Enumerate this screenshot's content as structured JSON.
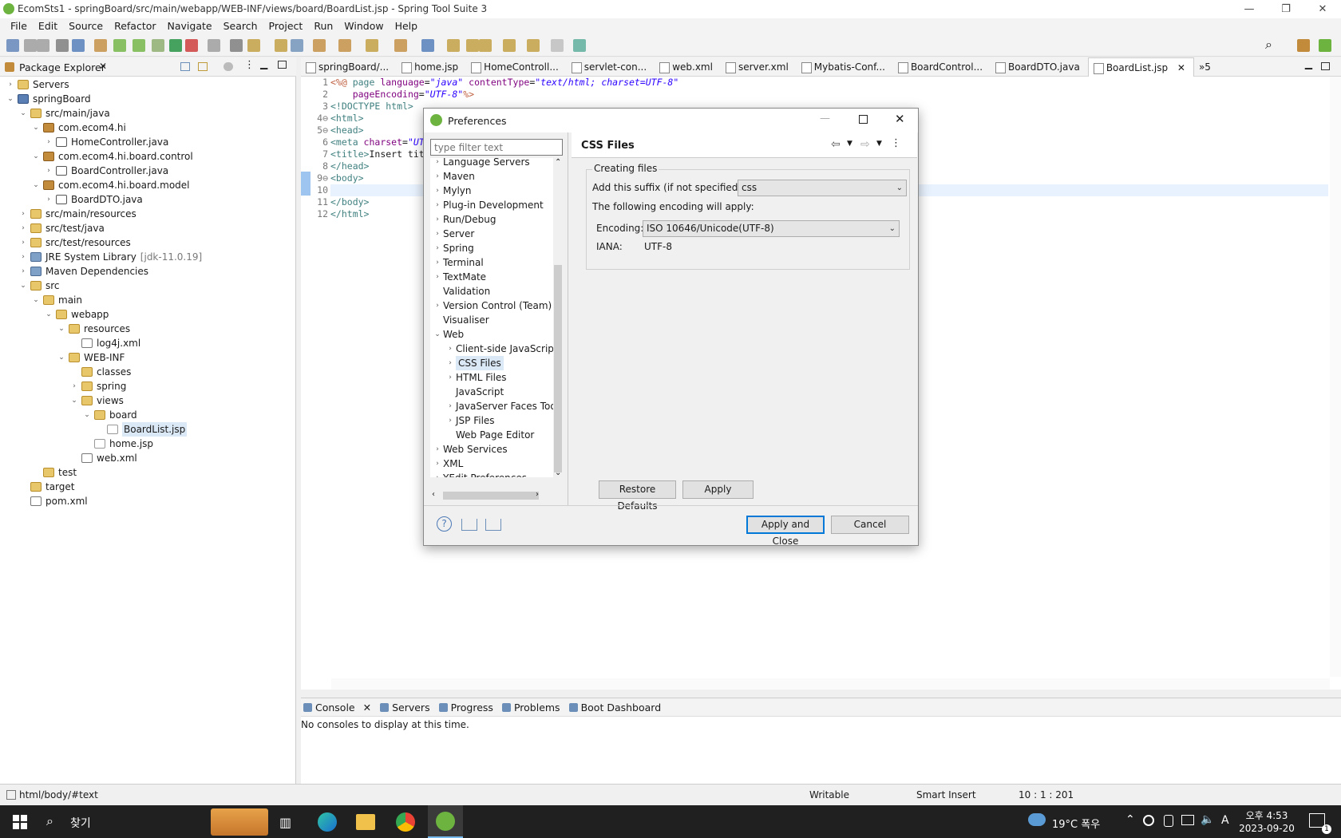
{
  "window": {
    "title": "EcomSts1 - springBoard/src/main/webapp/WEB-INF/views/board/BoardList.jsp - Spring Tool Suite 3",
    "minimize": "—",
    "maximize": "❐",
    "close": "✕"
  },
  "menu": [
    "File",
    "Edit",
    "Source",
    "Refactor",
    "Navigate",
    "Search",
    "Project",
    "Run",
    "Window",
    "Help"
  ],
  "package_explorer": {
    "title": "Package Explorer",
    "nodes": [
      {
        "label": "Servers",
        "depth": 0,
        "tw": "›",
        "icon": "folder"
      },
      {
        "label": "springBoard",
        "depth": 0,
        "tw": "⌄",
        "icon": "proj"
      },
      {
        "label": "src/main/java",
        "depth": 1,
        "tw": "⌄",
        "icon": "folder"
      },
      {
        "label": "com.ecom4.hi",
        "depth": 2,
        "tw": "⌄",
        "icon": "pkg"
      },
      {
        "label": "HomeController.java",
        "depth": 3,
        "tw": "›",
        "icon": "java"
      },
      {
        "label": "com.ecom4.hi.board.control",
        "depth": 2,
        "tw": "⌄",
        "icon": "pkg"
      },
      {
        "label": "BoardController.java",
        "depth": 3,
        "tw": "›",
        "icon": "java"
      },
      {
        "label": "com.ecom4.hi.board.model",
        "depth": 2,
        "tw": "⌄",
        "icon": "pkg"
      },
      {
        "label": "BoardDTO.java",
        "depth": 3,
        "tw": "›",
        "icon": "java"
      },
      {
        "label": "src/main/resources",
        "depth": 1,
        "tw": "›",
        "icon": "folder"
      },
      {
        "label": "src/test/java",
        "depth": 1,
        "tw": "›",
        "icon": "folder"
      },
      {
        "label": "src/test/resources",
        "depth": 1,
        "tw": "›",
        "icon": "folder"
      },
      {
        "label": "JRE System Library",
        "suffix": "[jdk-11.0.19]",
        "depth": 1,
        "tw": "›",
        "icon": "lib"
      },
      {
        "label": "Maven Dependencies",
        "depth": 1,
        "tw": "›",
        "icon": "lib"
      },
      {
        "label": "src",
        "depth": 1,
        "tw": "⌄",
        "icon": "folder"
      },
      {
        "label": "main",
        "depth": 2,
        "tw": "⌄",
        "icon": "folder"
      },
      {
        "label": "webapp",
        "depth": 3,
        "tw": "⌄",
        "icon": "folder"
      },
      {
        "label": "resources",
        "depth": 4,
        "tw": "⌄",
        "icon": "folder"
      },
      {
        "label": "log4j.xml",
        "depth": 5,
        "tw": "",
        "icon": "xml"
      },
      {
        "label": "WEB-INF",
        "depth": 4,
        "tw": "⌄",
        "icon": "folder"
      },
      {
        "label": "classes",
        "depth": 5,
        "tw": "",
        "icon": "folder"
      },
      {
        "label": "spring",
        "depth": 5,
        "tw": "›",
        "icon": "folder"
      },
      {
        "label": "views",
        "depth": 5,
        "tw": "⌄",
        "icon": "folder"
      },
      {
        "label": "board",
        "depth": 6,
        "tw": "⌄",
        "icon": "folder"
      },
      {
        "label": "BoardList.jsp",
        "depth": 7,
        "tw": "",
        "icon": "jsp",
        "selected": true
      },
      {
        "label": "home.jsp",
        "depth": 6,
        "tw": "",
        "icon": "jsp"
      },
      {
        "label": "web.xml",
        "depth": 5,
        "tw": "",
        "icon": "xml"
      },
      {
        "label": "test",
        "depth": 2,
        "tw": "",
        "icon": "folder"
      },
      {
        "label": "target",
        "depth": 1,
        "tw": "",
        "icon": "folder"
      },
      {
        "label": "pom.xml",
        "depth": 1,
        "tw": "",
        "icon": "xml"
      }
    ]
  },
  "editor_tabs": [
    "springBoard/...",
    "home.jsp",
    "HomeControll...",
    "servlet-con...",
    "web.xml",
    "server.xml",
    "Mybatis-Conf...",
    "BoardControl...",
    "BoardDTO.java",
    "BoardList.jsp"
  ],
  "editor_tabs_more": "»5",
  "code_lines": [
    {
      "n": "1",
      "segs": [
        [
          "t-dir",
          "<%@ "
        ],
        [
          "t-tag",
          "page "
        ],
        [
          "t-att",
          "language"
        ],
        [
          "",
          "="
        ],
        [
          "t-val",
          "\"java\""
        ],
        [
          "",
          " "
        ],
        [
          "t-att",
          "contentType"
        ],
        [
          "",
          "="
        ],
        [
          "t-val",
          "\"text/html; charset=UTF-8\""
        ]
      ]
    },
    {
      "n": "2",
      "segs": [
        [
          "",
          "    "
        ],
        [
          "t-att",
          "pageEncoding"
        ],
        [
          "",
          "="
        ],
        [
          "t-val",
          "\"UTF-8\""
        ],
        [
          "t-dir",
          "%>"
        ]
      ]
    },
    {
      "n": "3",
      "segs": [
        [
          "t-tag",
          "<!DOCTYPE html>"
        ]
      ]
    },
    {
      "n": "4⊖",
      "segs": [
        [
          "t-tag",
          "<html>"
        ]
      ]
    },
    {
      "n": "5⊖",
      "segs": [
        [
          "t-tag",
          "<head>"
        ]
      ]
    },
    {
      "n": "6",
      "segs": [
        [
          "t-tag",
          "<meta "
        ],
        [
          "t-att",
          "charset"
        ],
        [
          "",
          "="
        ],
        [
          "t-val",
          "\"UT"
        ]
      ]
    },
    {
      "n": "7",
      "segs": [
        [
          "t-tag",
          "<title>"
        ],
        [
          "",
          "Insert tit"
        ]
      ]
    },
    {
      "n": "8",
      "segs": [
        [
          "t-tag",
          "</head>"
        ]
      ]
    },
    {
      "n": "9⊖",
      "segs": [
        [
          "t-tag",
          "<body>"
        ]
      ]
    },
    {
      "n": "10",
      "segs": [
        [
          "",
          ""
        ]
      ],
      "highlight": true
    },
    {
      "n": "11",
      "segs": [
        [
          "t-tag",
          "</body>"
        ]
      ]
    },
    {
      "n": "12",
      "segs": [
        [
          "t-tag",
          "</html>"
        ]
      ]
    }
  ],
  "console": {
    "tabs": [
      "Console",
      "Servers",
      "Progress",
      "Problems",
      "Boot Dashboard"
    ],
    "message": "No consoles to display at this time."
  },
  "status": {
    "path": "html/body/#text",
    "writable": "Writable",
    "insert": "Smart Insert",
    "pos": "10 : 1 : 201"
  },
  "taskbar": {
    "search": "찾기",
    "weather": "19°C  폭우",
    "time": "오후 4:53",
    "date": "2023-09-20",
    "ime": "A",
    "notif": "1"
  },
  "dialog": {
    "title": "Preferences",
    "filter_placeholder": "type filter text",
    "tree": [
      {
        "label": "Language Servers",
        "depth": 0,
        "tw": "›"
      },
      {
        "label": "Maven",
        "depth": 0,
        "tw": "›"
      },
      {
        "label": "Mylyn",
        "depth": 0,
        "tw": "›"
      },
      {
        "label": "Plug-in Development",
        "depth": 0,
        "tw": "›"
      },
      {
        "label": "Run/Debug",
        "depth": 0,
        "tw": "›"
      },
      {
        "label": "Server",
        "depth": 0,
        "tw": "›"
      },
      {
        "label": "Spring",
        "depth": 0,
        "tw": "›"
      },
      {
        "label": "Terminal",
        "depth": 0,
        "tw": "›"
      },
      {
        "label": "TextMate",
        "depth": 0,
        "tw": "›"
      },
      {
        "label": "Validation",
        "depth": 0,
        "tw": ""
      },
      {
        "label": "Version Control (Team)",
        "depth": 0,
        "tw": "›"
      },
      {
        "label": "Visualiser",
        "depth": 0,
        "tw": ""
      },
      {
        "label": "Web",
        "depth": 0,
        "tw": "⌄"
      },
      {
        "label": "Client-side JavaScript",
        "depth": 1,
        "tw": "›"
      },
      {
        "label": "CSS Files",
        "depth": 1,
        "tw": "›",
        "selected": true
      },
      {
        "label": "HTML Files",
        "depth": 1,
        "tw": "›"
      },
      {
        "label": "JavaScript",
        "depth": 1,
        "tw": ""
      },
      {
        "label": "JavaServer Faces Tools",
        "depth": 1,
        "tw": "›"
      },
      {
        "label": "JSP Files",
        "depth": 1,
        "tw": "›"
      },
      {
        "label": "Web Page Editor",
        "depth": 1,
        "tw": ""
      },
      {
        "label": "Web Services",
        "depth": 0,
        "tw": "›"
      },
      {
        "label": "XML",
        "depth": 0,
        "tw": "›"
      },
      {
        "label": "YEdit Preferences",
        "depth": 0,
        "tw": "›"
      }
    ],
    "page_title": "CSS Files",
    "group_label": "Creating files",
    "suffix_label": "Add this suffix (if not specified):",
    "suffix_value": "css",
    "encoding_note": "The following encoding will apply:",
    "encoding_label": "Encoding:",
    "encoding_value": "ISO 10646/Unicode(UTF-8)",
    "iana_label": "IANA:",
    "iana_value": "UTF-8",
    "restore_defaults": "Restore Defaults",
    "apply": "Apply",
    "apply_close": "Apply and Close",
    "cancel": "Cancel"
  }
}
